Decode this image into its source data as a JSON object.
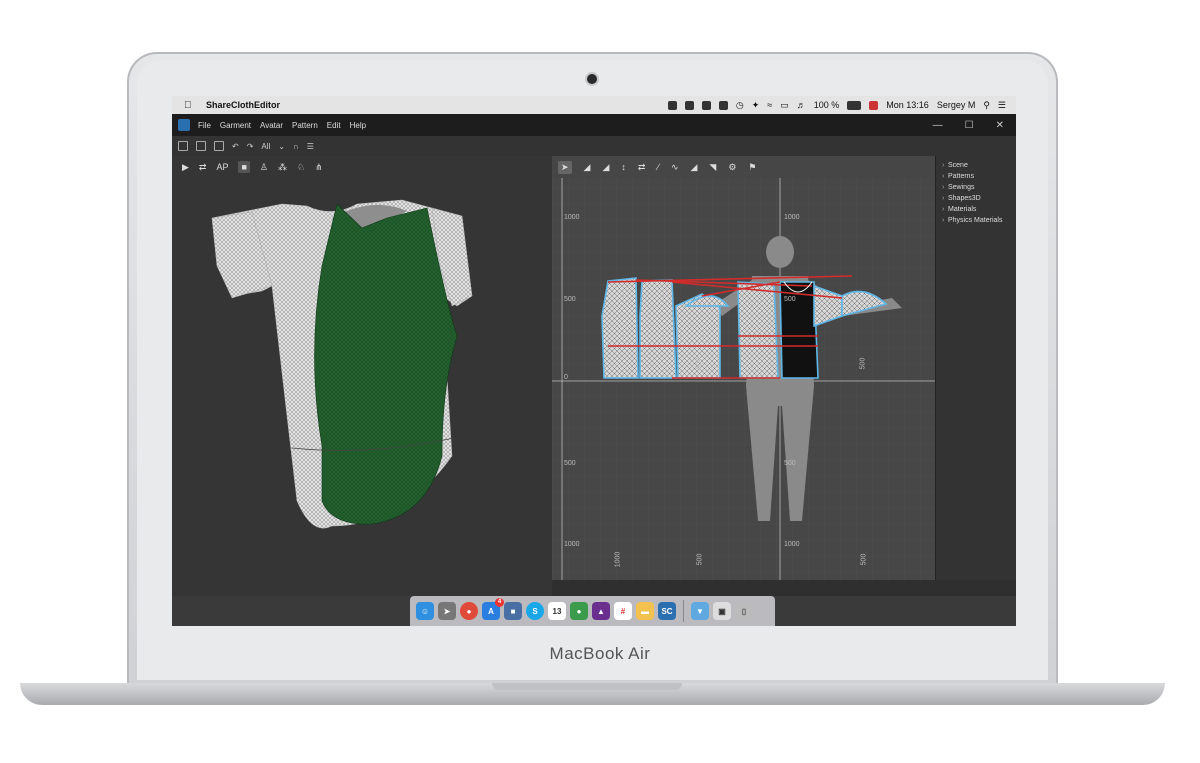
{
  "device": {
    "brand": "MacBook Air"
  },
  "mac_menubar": {
    "app_name": "ShareClothEditor",
    "battery": "100 %",
    "clock": "Mon 13:16",
    "user": "Sergey M"
  },
  "app": {
    "menus": [
      "File",
      "Garment",
      "Avatar",
      "Pattern",
      "Edit",
      "Help"
    ],
    "window_controls": {
      "minimize": "—",
      "maximize": "☐",
      "close": "✕"
    },
    "toolbar": {
      "filter_value": "All"
    },
    "view3d_toolbar": {
      "ap_label": "AP"
    },
    "view2d": {
      "ruler_labels_left": [
        "1000",
        "500",
        "0",
        "500",
        "1000"
      ],
      "ruler_labels_right": [
        "1000",
        "500",
        "500",
        "1000"
      ],
      "ruler_labels_bottom": [
        "1000",
        "500",
        "500"
      ],
      "ruler_labels_piece": [
        "500",
        "500"
      ]
    },
    "tree": [
      "Scene",
      "Patterns",
      "Sewings",
      "Shapes3D",
      "Materials",
      "Physics Materials"
    ]
  },
  "dock": {
    "notification_badge": "4",
    "calendar_day": "13",
    "app_abbrev": "SC",
    "skype_letter": "S"
  },
  "colors": {
    "garment_green": "#1f5a2c",
    "garment_white": "#d8d8d8",
    "seam_red": "#d42b2b",
    "pattern_blue": "#5fb7e8"
  }
}
